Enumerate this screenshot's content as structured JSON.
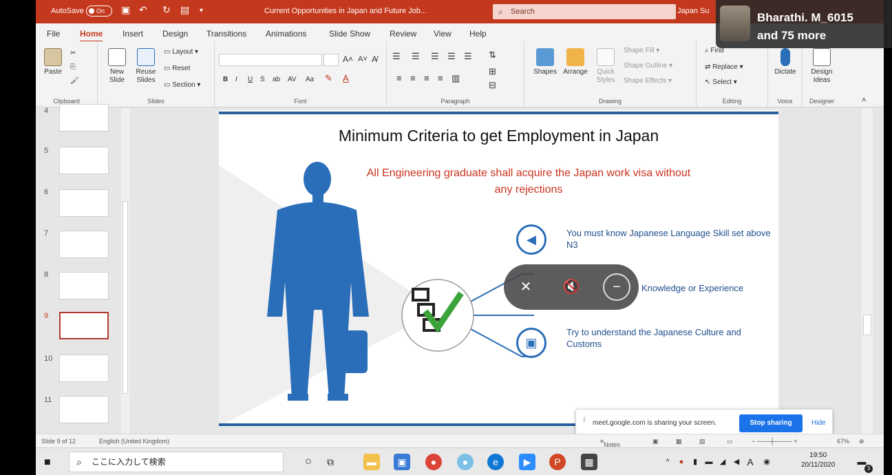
{
  "titlebar": {
    "autosave": "AutoSave",
    "autosave_state": "On",
    "document_title": "Current Opportunities in Japan and Future Job...",
    "search_placeholder": "Search",
    "user": "Japan Su"
  },
  "presenter": {
    "name": "Bharathi. M_6015",
    "others": "and 75 more"
  },
  "tabs": [
    "File",
    "Home",
    "Insert",
    "Design",
    "Transitions",
    "Animations",
    "Slide Show",
    "Review",
    "View",
    "Help"
  ],
  "ribbon": {
    "clipboard": {
      "paste": "Paste",
      "label": "Clipboard"
    },
    "slides": {
      "new_slide": "New Slide",
      "reuse_slides": "Reuse Slides",
      "layout": "Layout",
      "reset": "Reset",
      "section": "Section",
      "label": "Slides"
    },
    "font": {
      "label": "Font",
      "bold": "B",
      "italic": "I",
      "underline": "U",
      "strike": "S"
    },
    "paragraph": {
      "label": "Paragraph"
    },
    "drawing": {
      "shapes": "Shapes",
      "arrange": "Arrange",
      "quick_styles": "Quick Styles",
      "shape_fill": "Shape Fill",
      "shape_outline": "Shape Outline",
      "shape_effects": "Shape Effects",
      "label": "Drawing"
    },
    "editing": {
      "find": "Find",
      "replace": "Replace",
      "select": "Select",
      "label": "Editing"
    },
    "voice": {
      "dictate": "Dictate",
      "label": "Voice"
    },
    "designer": {
      "design_ideas": "Design Ideas",
      "label": "Designer"
    }
  },
  "thumbnails": [
    {
      "num": "4"
    },
    {
      "num": "5"
    },
    {
      "num": "6"
    },
    {
      "num": "7"
    },
    {
      "num": "8"
    },
    {
      "num": "9"
    },
    {
      "num": "10"
    },
    {
      "num": "11"
    }
  ],
  "slide": {
    "title": "Minimum Criteria to get Employment in Japan",
    "subtitle": "All Engineering graduate shall acquire the Japan work visa  without any rejections",
    "points": [
      "You must know Japanese Language Skill set above N3",
      "Knowledge or Experience",
      "Try to understand the Japanese Culture and Customs"
    ]
  },
  "status": {
    "slide_count": "Slide 9 of 12",
    "language": "English (United Kingdom)",
    "notes": "Notes",
    "zoom": "67%"
  },
  "share_bar": {
    "message": "meet.google.com is sharing your screen.",
    "stop": "Stop sharing",
    "hide": "Hide"
  },
  "taskbar": {
    "search_placeholder": "ここに入力して検索",
    "ime": "A",
    "time": "19:50",
    "date": "20/11/2020",
    "notifications": "3"
  },
  "colors": {
    "accent": "#c4391d",
    "slide_blue": "#2a6db8",
    "subtitle_red": "#c8331f",
    "meet_blue": "#1a73e8"
  }
}
